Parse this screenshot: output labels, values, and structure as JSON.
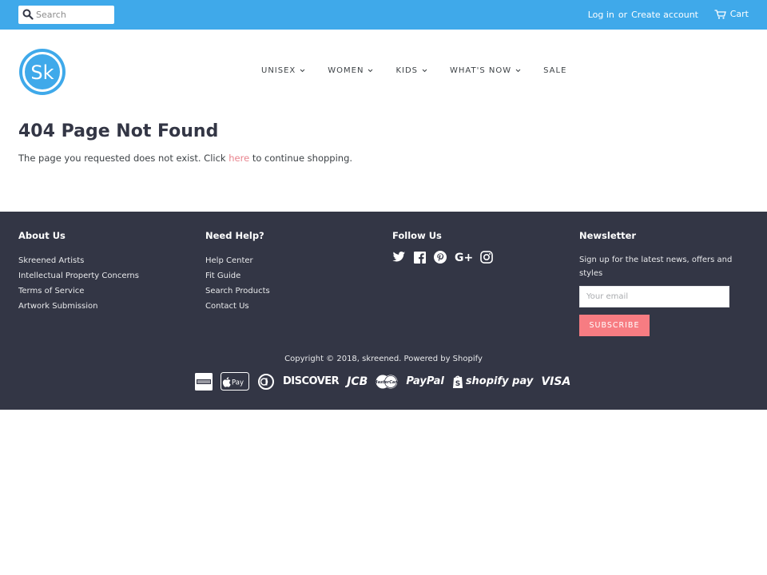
{
  "topbar": {
    "search_placeholder": "Search",
    "login": "Log in",
    "or": "or",
    "create_account": "Create account",
    "cart": "Cart"
  },
  "header": {
    "logo_text": "Sk",
    "nav": [
      {
        "label": "UNISEX"
      },
      {
        "label": "WOMEN"
      },
      {
        "label": "KIDS"
      },
      {
        "label": "WHAT'S NOW"
      },
      {
        "label": "SALE"
      }
    ]
  },
  "main": {
    "title": "404 Page Not Found",
    "message_before": "The page you requested does not exist. Click ",
    "message_link": "here",
    "message_after": " to continue shopping."
  },
  "footer": {
    "about": {
      "heading": "About Us",
      "links": [
        "Skreened Artists",
        "Intellectual Property Concerns",
        "Terms of Service",
        "Artwork Submission"
      ]
    },
    "help": {
      "heading": "Need Help?",
      "links": [
        "Help Center",
        "Fit Guide",
        "Search Products",
        "Contact Us"
      ]
    },
    "follow": {
      "heading": "Follow Us",
      "icons": [
        "twitter-icon",
        "facebook-icon",
        "pinterest-icon",
        "google-plus-icon",
        "instagram-icon"
      ]
    },
    "newsletter": {
      "heading": "Newsletter",
      "text": "Sign up for the latest news, offers and styles",
      "email_placeholder": "Your email",
      "subscribe": "SUBSCRIBE"
    },
    "copyright": "Copyright © 2018, skreened. Powered by Shopify",
    "payments": {
      "discover": "DISCOVER",
      "jcb": "JCB",
      "paypal": "PayPal",
      "shopify_pay": "shopify pay",
      "visa": "VISA"
    }
  },
  "colors": {
    "topbar": "#3fa9ea",
    "footer": "#333645",
    "link_accent": "#e8838d",
    "subscribe": "#f77c82"
  }
}
